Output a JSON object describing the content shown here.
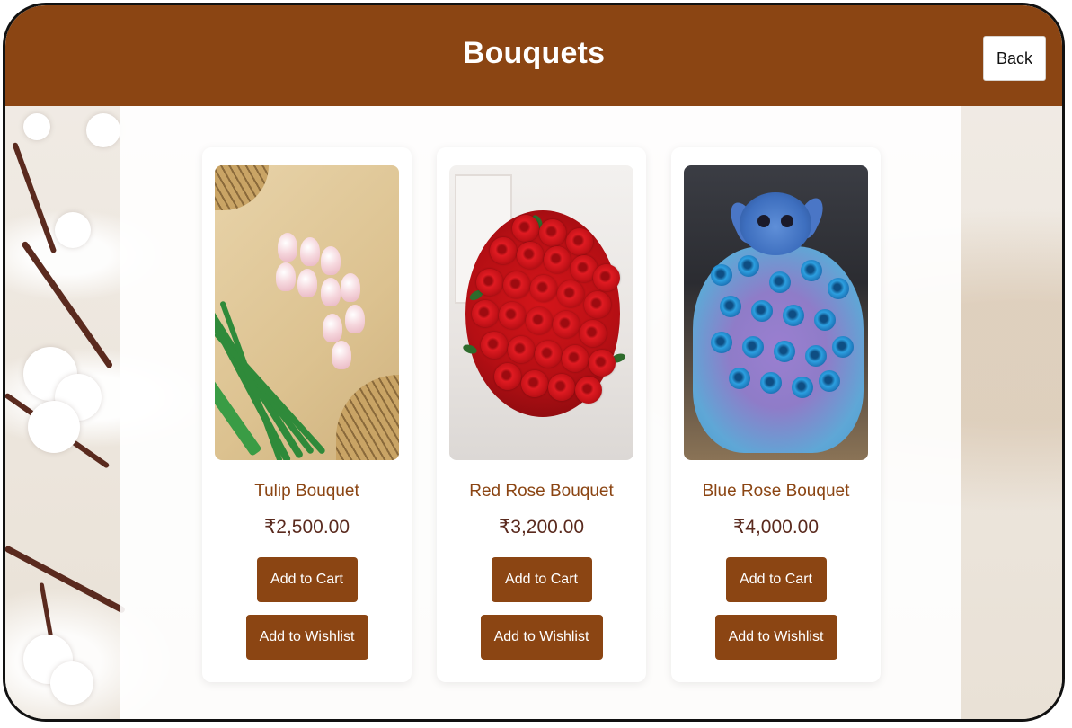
{
  "header": {
    "title": "Bouquets",
    "back_label": "Back"
  },
  "colors": {
    "brand": "#8B4513",
    "card_bg": "#FFFFFF",
    "button_text": "#FFFFFF"
  },
  "products": [
    {
      "name": "Tulip Bouquet",
      "price": "₹2,500.00",
      "add_to_cart_label": "Add to Cart",
      "add_to_wishlist_label": "Add to Wishlist"
    },
    {
      "name": "Red Rose Bouquet",
      "price": "₹3,200.00",
      "add_to_cart_label": "Add to Cart",
      "add_to_wishlist_label": "Add to Wishlist"
    },
    {
      "name": "Blue Rose Bouquet",
      "price": "₹4,000.00",
      "add_to_cart_label": "Add to Cart",
      "add_to_wishlist_label": "Add to Wishlist"
    }
  ]
}
